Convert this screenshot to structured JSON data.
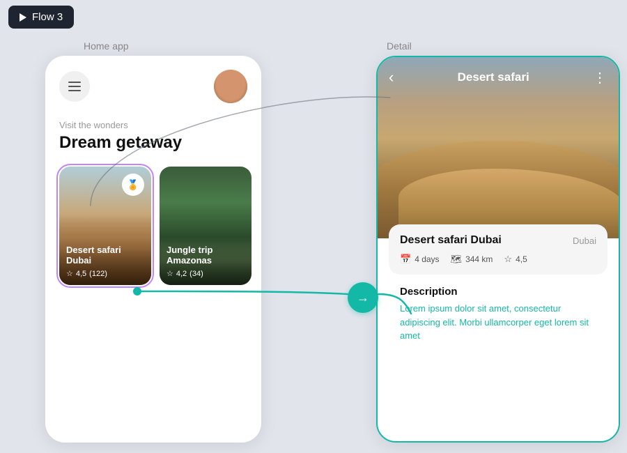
{
  "toolbar": {
    "flow_label": "Flow 3"
  },
  "labels": {
    "home_app": "Home app",
    "detail": "Detail"
  },
  "home_app": {
    "hero_subtitle": "Visit the wonders",
    "hero_title": "Dream getaway",
    "menu_icon": "☰",
    "cards": [
      {
        "id": "desert",
        "title": "Desert safari Dubai",
        "rating": "4,5",
        "reviews": "(122)",
        "selected": true,
        "badge": "🏅"
      },
      {
        "id": "jungle",
        "title": "Jungle trip Amazonas",
        "rating": "4,2",
        "reviews": "(34)",
        "selected": false,
        "badge": null
      }
    ]
  },
  "detail": {
    "nav_title": "Desert safari",
    "back_icon": "‹",
    "menu_icon": "⋮",
    "info": {
      "title": "Desert safari Dubai",
      "location": "Dubai",
      "days": "4 days",
      "distance": "344 km",
      "rating": "4,5"
    },
    "description": {
      "title": "Description",
      "text": "Lorem ipsum dolor sit amet, consectetur adipiscing elit. Morbi ullamcorper eget lorem sit amet"
    }
  },
  "connector": {
    "arrow_label": "→"
  }
}
